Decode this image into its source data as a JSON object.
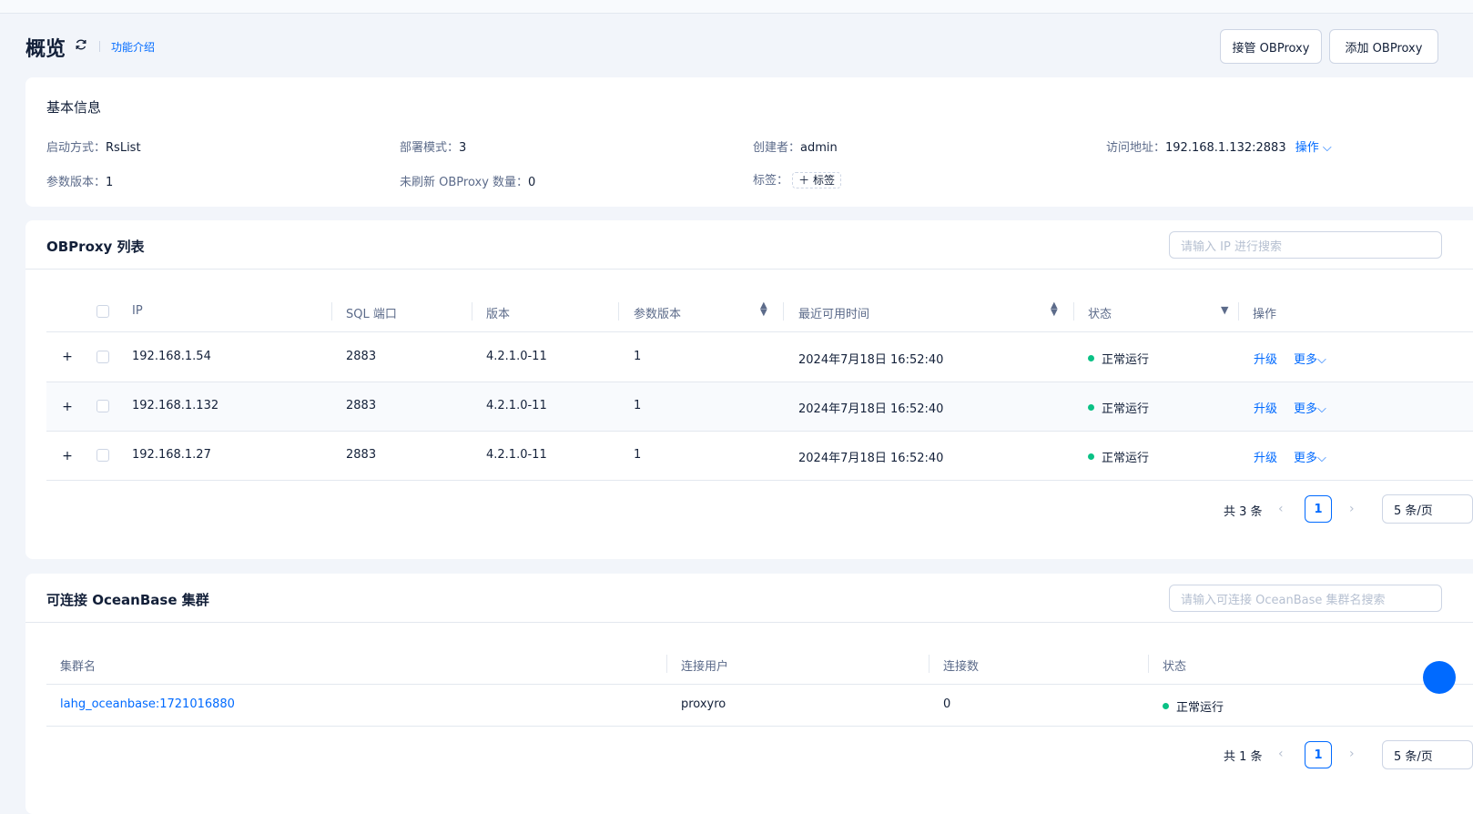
{
  "header": {
    "title": "概览",
    "intro_link": "功能介绍",
    "takeover_button": "接管 OBProxy",
    "add_button": "添加 OBProxy"
  },
  "basic_info": {
    "title": "基本信息",
    "startup_label": "启动方式：",
    "startup_value": "RsList",
    "deploy_label": "部署模式：",
    "deploy_value": "3",
    "creator_label": "创建者：",
    "creator_value": "admin",
    "address_label": "访问地址：",
    "address_value": "192.168.1.132:2883",
    "address_action": "操作",
    "param_label": "参数版本：",
    "param_value": "1",
    "unrefreshed_label": "未刷新 OBProxy 数量：",
    "unrefreshed_value": "0",
    "tags_label": "标签：",
    "tags_button": "标签"
  },
  "proxy_list": {
    "title": "OBProxy 列表",
    "search_placeholder": "请输入 IP 进行搜索",
    "columns": [
      "IP",
      "SQL 端口",
      "版本",
      "参数版本",
      "最近可用时间",
      "状态",
      "操作"
    ],
    "rows": [
      {
        "ip": "192.168.1.54",
        "port": "2883",
        "version": "4.2.1.0-11",
        "param": "1",
        "time": "2024年7月18日 16:52:40",
        "status": "正常运行",
        "upgrade": "升级",
        "more": "更多"
      },
      {
        "ip": "192.168.1.132",
        "port": "2883",
        "version": "4.2.1.0-11",
        "param": "1",
        "time": "2024年7月18日 16:52:40",
        "status": "正常运行",
        "upgrade": "升级",
        "more": "更多"
      },
      {
        "ip": "192.168.1.27",
        "port": "2883",
        "version": "4.2.1.0-11",
        "param": "1",
        "time": "2024年7月18日 16:52:40",
        "status": "正常运行",
        "upgrade": "升级",
        "more": "更多"
      }
    ],
    "total": "共 3 条",
    "page": "1",
    "page_size": "5 条/页"
  },
  "clusters": {
    "title": "可连接 OceanBase 集群",
    "search_placeholder": "请输入可连接 OceanBase 集群名搜索",
    "columns": [
      "集群名",
      "连接用户",
      "连接数",
      "状态"
    ],
    "rows": [
      {
        "name": "lahg_oceanbase:1721016880",
        "user": "proxyro",
        "connections": "0",
        "status": "正常运行"
      }
    ],
    "total": "共 1 条",
    "page": "1",
    "page_size": "5 条/页"
  },
  "colors": {
    "accent": "#006aff",
    "success": "#0ac185",
    "background": "#f2f5fa"
  }
}
